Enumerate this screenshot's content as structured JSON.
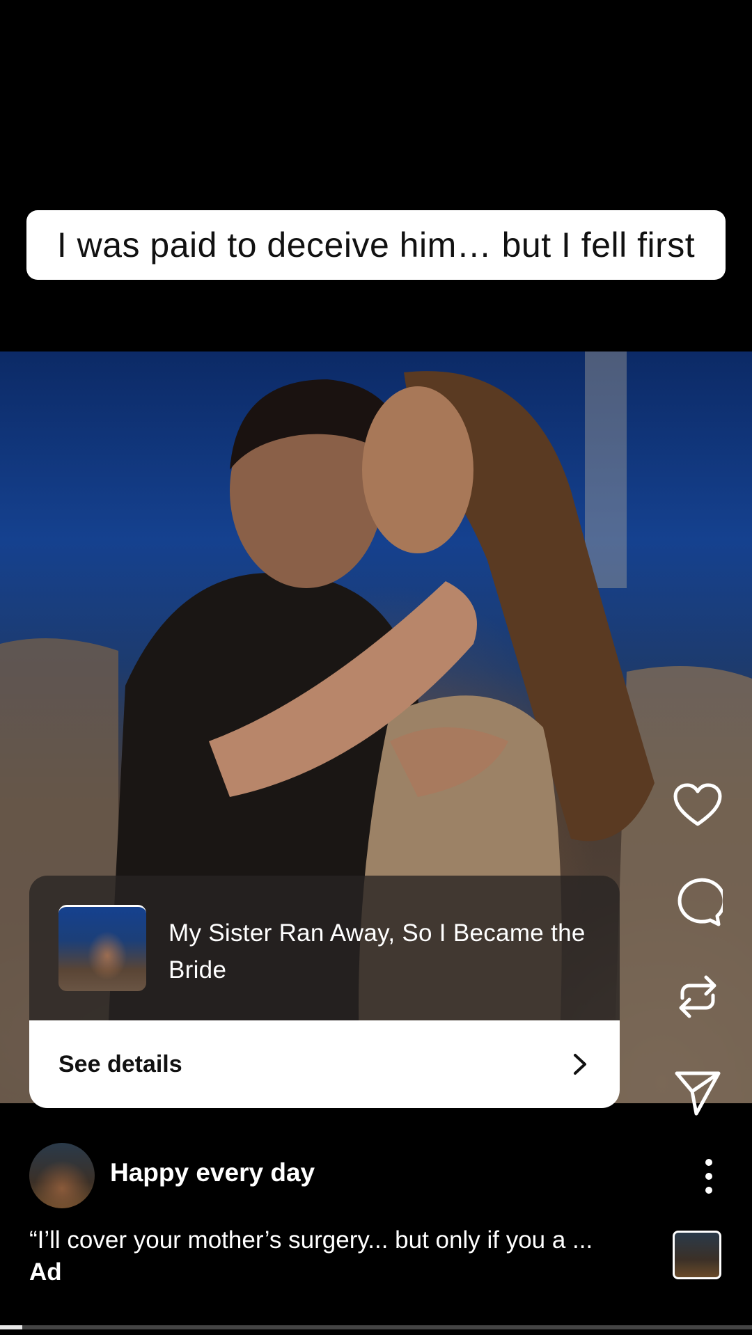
{
  "caption": "I was paid to deceive him… but I fell first",
  "product": {
    "title": "My Sister Ran Away, So I Became the Bride",
    "cta": "See details"
  },
  "actions": [
    {
      "name": "like",
      "icon": "heart-icon"
    },
    {
      "name": "comment",
      "icon": "comment-icon"
    },
    {
      "name": "repost",
      "icon": "repost-icon"
    },
    {
      "name": "share",
      "icon": "send-icon"
    }
  ],
  "account": {
    "username": "Happy every day"
  },
  "ad": {
    "caption": "“I’ll cover your mother’s surgery... but only if you a ...",
    "label": "Ad"
  },
  "playback": {
    "progress": 0.03
  },
  "colors": {
    "background": "#000000",
    "card_button": "#ffffff",
    "text": "#ffffff"
  }
}
